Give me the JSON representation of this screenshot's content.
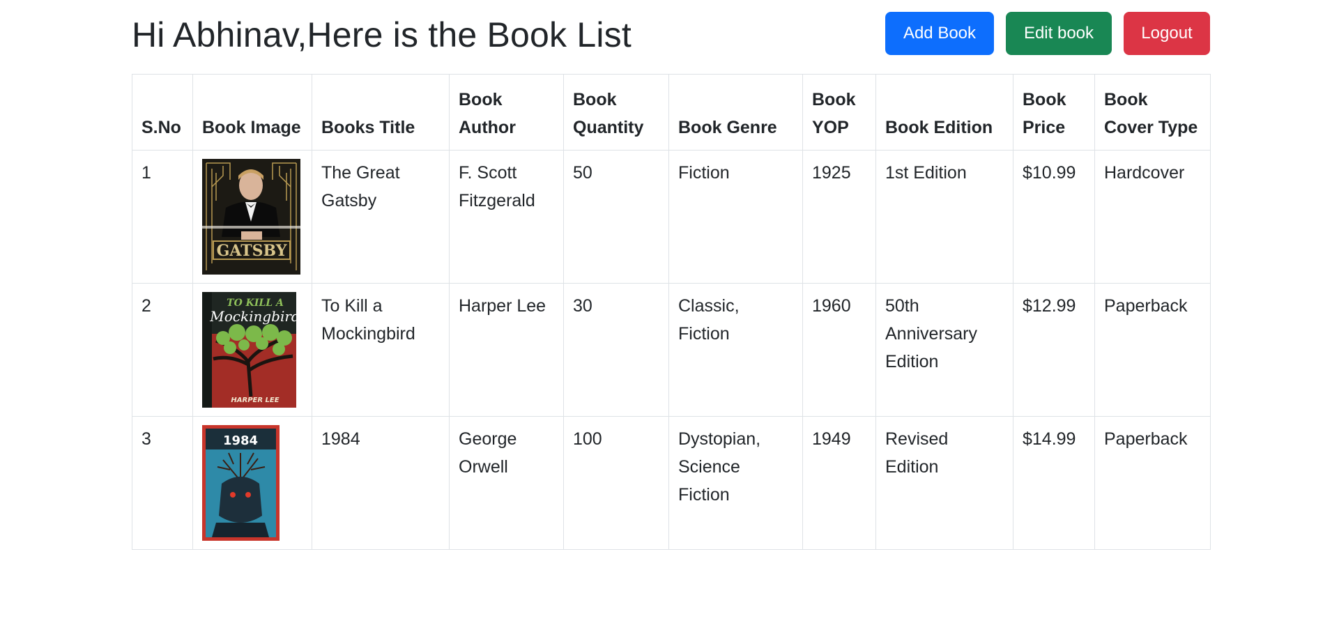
{
  "header": {
    "title": "Hi Abhinav,Here is the Book List",
    "buttons": {
      "add": "Add Book",
      "edit": "Edit book",
      "logout": "Logout"
    }
  },
  "colors": {
    "primary": "#0d6efd",
    "success": "#198754",
    "danger": "#dc3545"
  },
  "table": {
    "columns": [
      "S.No",
      "Book Image",
      "Books Title",
      "Book Author",
      "Book Quantity",
      "Book Genre",
      "Book YOP",
      "Book Edition",
      "Book Price",
      "Book Cover Type"
    ],
    "rows": [
      {
        "sno": "1",
        "image": "gatsby-cover",
        "title": "The Great Gatsby",
        "author": "F. Scott Fitzgerald",
        "quantity": "50",
        "genre": "Fiction",
        "yop": "1925",
        "edition": "1st Edition",
        "price": "$10.99",
        "cover_type": "Hardcover"
      },
      {
        "sno": "2",
        "image": "mockingbird-cover",
        "title": "To Kill a Mockingbird",
        "author": "Harper Lee",
        "quantity": "30",
        "genre": "Classic, Fiction",
        "yop": "1960",
        "edition": "50th Anniversary Edition",
        "price": "$12.99",
        "cover_type": "Paperback"
      },
      {
        "sno": "3",
        "image": "1984-cover",
        "title": "1984",
        "author": "George Orwell",
        "quantity": "100",
        "genre": "Dystopian, Science Fiction",
        "yop": "1949",
        "edition": "Revised Edition",
        "price": "$14.99",
        "cover_type": "Paperback"
      }
    ],
    "cover_text": {
      "gatsby": "GATSBY",
      "mockingbird_top": "TO KILL A",
      "mockingbird_title": "Mockingbird",
      "mockingbird_author": "HARPER LEE",
      "nineteen": "1984"
    }
  }
}
